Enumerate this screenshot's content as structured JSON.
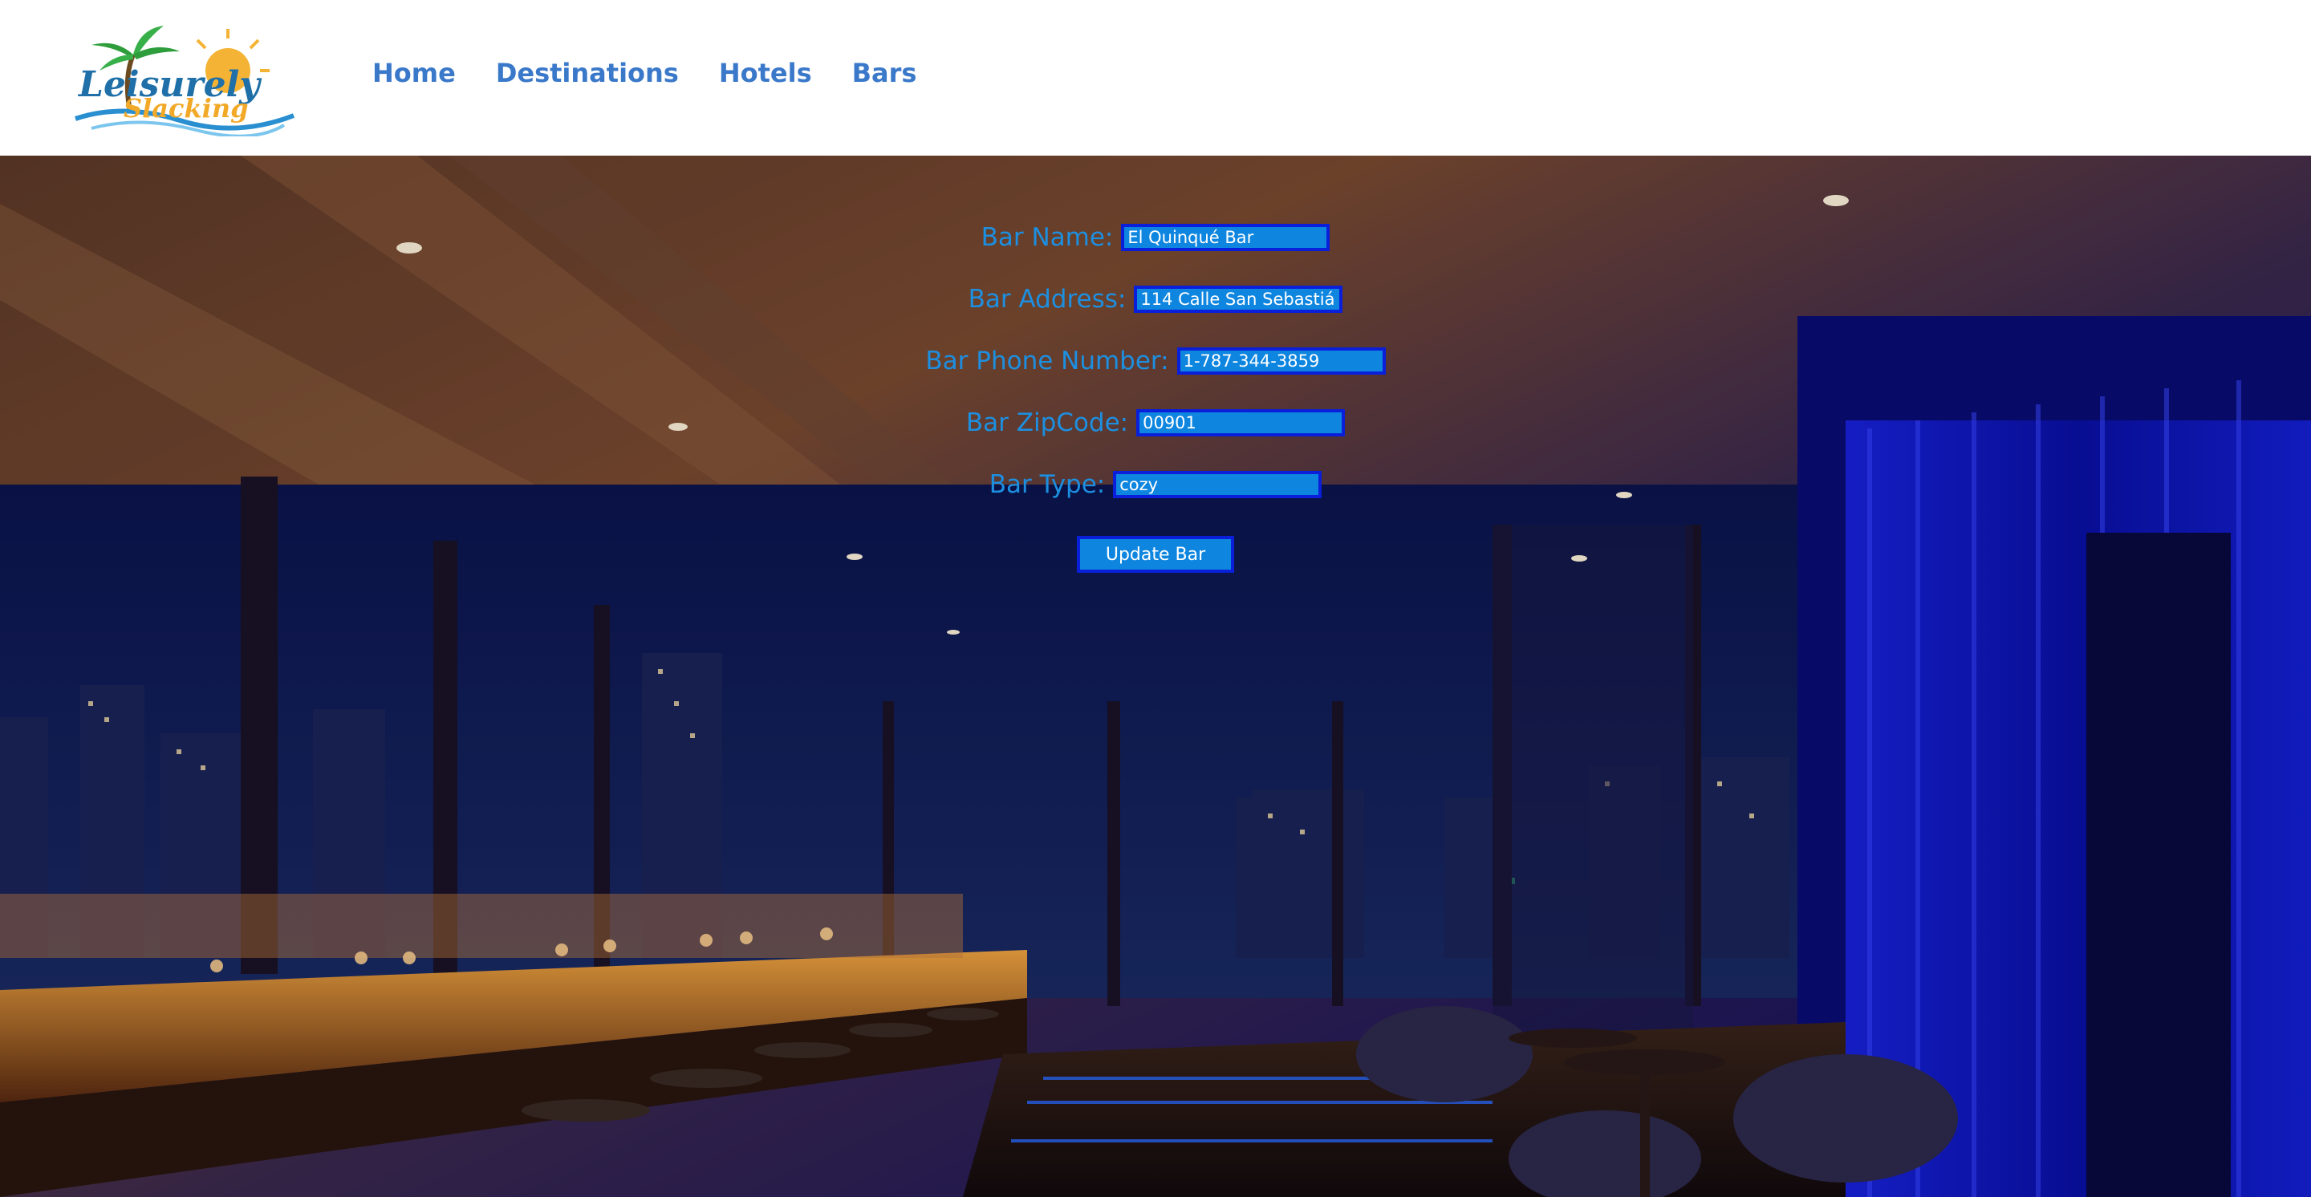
{
  "header": {
    "logo": {
      "top_text": "Leisurely",
      "bottom_text": "Slacking"
    },
    "nav": [
      {
        "label": "Home"
      },
      {
        "label": "Destinations"
      },
      {
        "label": "Hotels"
      },
      {
        "label": "Bars"
      }
    ]
  },
  "form": {
    "fields": [
      {
        "label": "Bar Name:",
        "value": "El Quinqué Bar"
      },
      {
        "label": "Bar Address:",
        "value": "114 Calle San Sebastián"
      },
      {
        "label": "Bar Phone Number:",
        "value": "1-787-344-3859"
      },
      {
        "label": "Bar ZipCode:",
        "value": "00901"
      },
      {
        "label": "Bar Type:",
        "value": "cozy"
      }
    ],
    "submit_label": "Update Bar"
  },
  "colors": {
    "nav_text": "#3a78c9",
    "label_text": "#1d8fe0",
    "input_bg": "#0e86e0",
    "input_border": "#0a1fd9"
  }
}
